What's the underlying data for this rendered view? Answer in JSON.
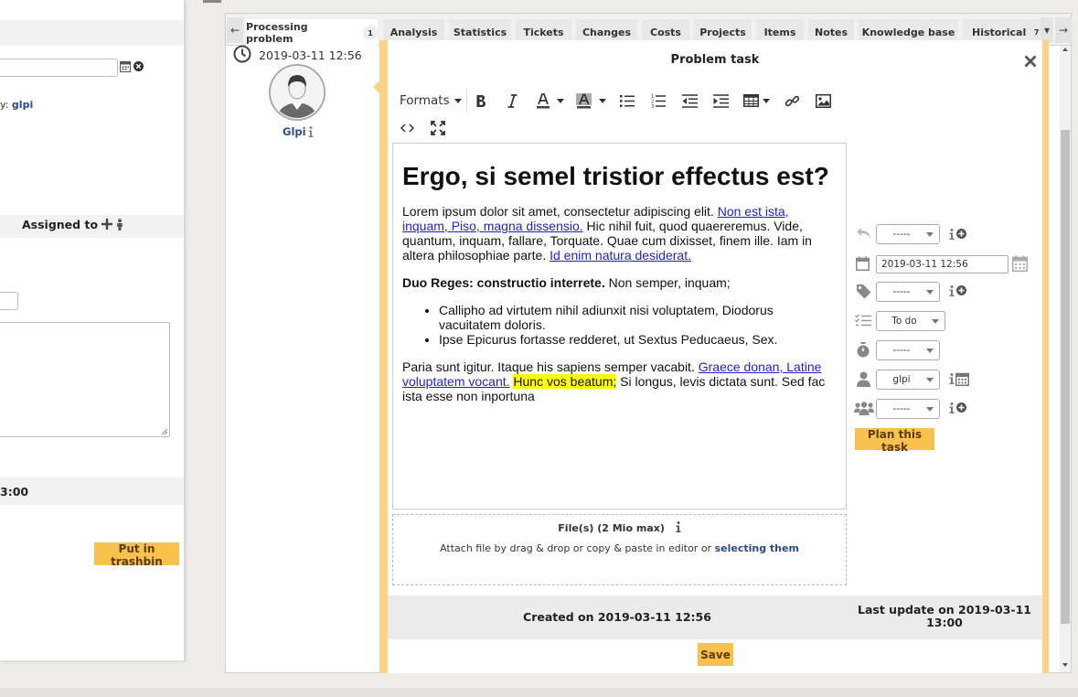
{
  "left_panel": {
    "by_label": "y:",
    "by_user": "glpi",
    "assigned_to_label": "Assigned to",
    "date_fragment": "3:00",
    "trash_label": "Put in trashbin"
  },
  "tabs": {
    "items": [
      {
        "label": "Processing problem",
        "badge": "1"
      },
      {
        "label": "Analysis"
      },
      {
        "label": "Statistics"
      },
      {
        "label": "Tickets"
      },
      {
        "label": "Changes"
      },
      {
        "label": "Costs"
      },
      {
        "label": "Projects"
      },
      {
        "label": "Items"
      },
      {
        "label": "Notes"
      },
      {
        "label": "Knowledge base"
      },
      {
        "label": "Historical",
        "badge": "7"
      }
    ],
    "prev_arrow": "←",
    "next_arrow": "→",
    "dropdown_caret": "▾"
  },
  "timeline": {
    "datetime": "2019-03-11 12:56",
    "user_name": "Glpi"
  },
  "popup": {
    "title": "Problem task",
    "toolbar": {
      "formats_label": "Formats"
    },
    "editor": {
      "heading": "Ergo, si semel tristior effectus est?",
      "p1_text_a": "Lorem ipsum dolor sit amet, consectetur adipiscing elit. ",
      "p1_link1": "Non est ista, inquam, Piso, magna dissensio.",
      "p1_text_b": " Hic nihil fuit, quod quaereremus. Vide, quantum, inquam, fallare, Torquate. Quae cum dixisset, finem ille. Iam in altera philosophiae parte. ",
      "p1_link2": "Id enim natura desiderat.",
      "p2_bold": "Duo Reges: constructio interrete.",
      "p2_text": " Non semper, inquam;",
      "list": [
        "Callipho ad virtutem nihil adiunxit nisi voluptatem, Diodorus vacuitatem doloris.",
        "Ipse Epicurus fortasse redderet, ut Sextus Peducaeus, Sex."
      ],
      "p3_text_a": "Paria sunt igitur. Itaque his sapiens semper vacabit. ",
      "p3_link": "Graece donan, Latine voluptatem vocant.",
      "p3_space": " ",
      "p3_highlight": "Hunc vos beatum;",
      "p3_text_b": " Si longus, levis dictata sunt. Sed fac ista esse non inportuna"
    },
    "dropzone": {
      "title": "File(s) (2 Mio max)",
      "text": "Attach file by drag & drop or copy & paste in editor or ",
      "link": "selecting them"
    },
    "fields": {
      "source_value": "-----",
      "date_value": "2019-03-11 12:56",
      "category_value": "-----",
      "status_value": "To do",
      "duration_value": "-----",
      "user_value": "glpi",
      "group_value": "-----"
    },
    "plan_label": "Plan this task",
    "created_text": "Created on 2019-03-11 12:56",
    "updated_line1": "Last update on 2019-03-11",
    "updated_line2": "13:00",
    "save_label": "Save"
  },
  "colors": {
    "accent": "#f9c14e",
    "popup_border": "#fbd387",
    "link": "#2a4b87",
    "highlight": "#ffff00"
  }
}
